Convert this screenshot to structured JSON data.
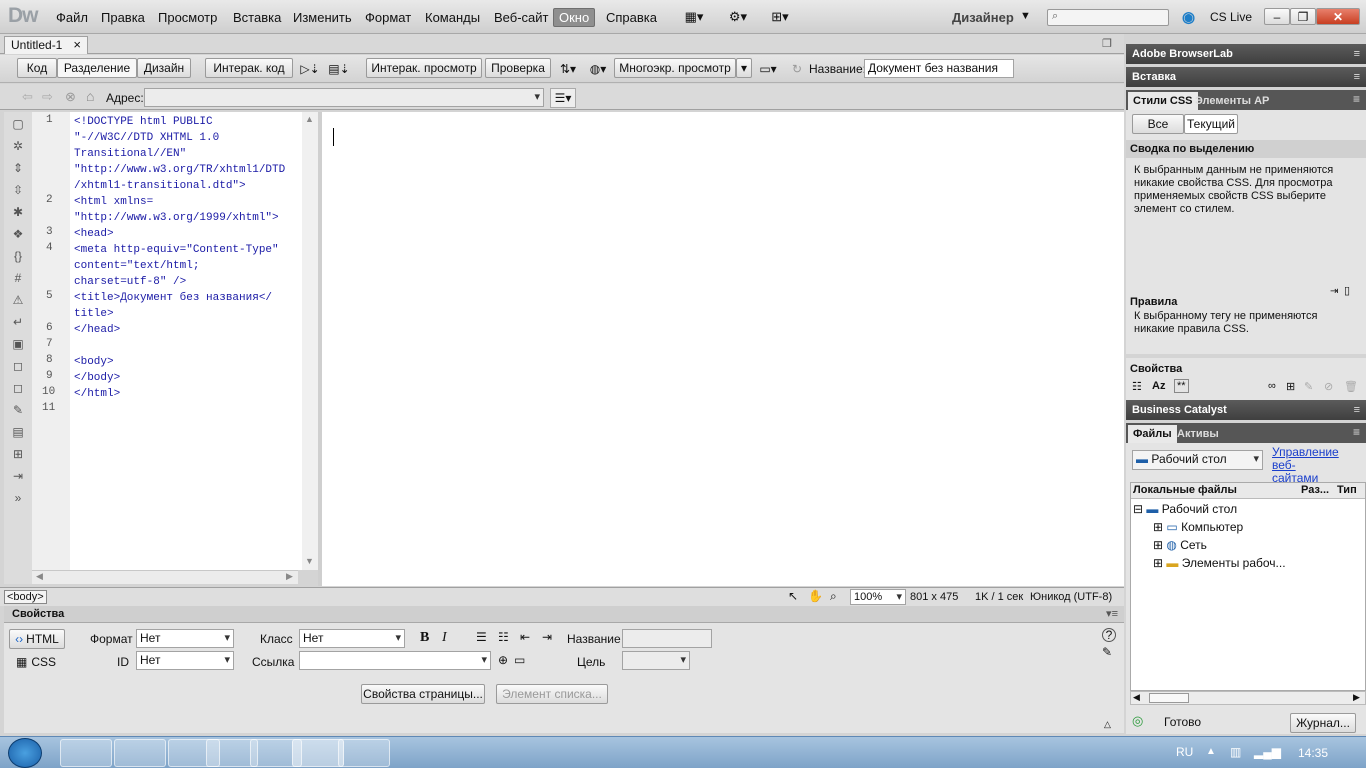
{
  "app": {
    "logo": "Dw",
    "workspace": "Дизайнер",
    "cslive": "CS Live"
  },
  "menu": [
    "Файл",
    "Правка",
    "Просмотр",
    "Вставка",
    "Изменить",
    "Формат",
    "Команды",
    "Веб-сайт",
    "Окно",
    "Справка"
  ],
  "doc_tab": {
    "title": "Untitled-1",
    "close": "×"
  },
  "toolbar": {
    "code": "Код",
    "split": "Разделение",
    "design": "Дизайн",
    "live_code": "Интерак. код",
    "live_view": "Интерак. просмотр",
    "check": "Проверка",
    "multiscreen": "Многоэкр. просмотр",
    "title_label": "Название:",
    "title_value": "Документ без названия"
  },
  "address": {
    "label": "Адрес:",
    "value": ""
  },
  "code": {
    "line_numbers": [
      "1",
      "2",
      "3",
      "4",
      "5",
      "6",
      "7",
      "8",
      "9",
      "10",
      "11"
    ],
    "text": "<!DOCTYPE html PUBLIC\n\"-//W3C//DTD XHTML 1.0\nTransitional//EN\"\n\"http://www.w3.org/TR/xhtml1/DTD\n/xhtml1-transitional.dtd\">\n<html xmlns=\n\"http://www.w3.org/1999/xhtml\">\n<head>\n<meta http-equiv=\"Content-Type\"\ncontent=\"text/html;\ncharset=utf-8\" />\n<title>Документ без названия</\ntitle>\n</head>\n\n<body>\n</body>\n</html>"
  },
  "status": {
    "tag": "<body>",
    "zoom": "100%",
    "size": "801 x 475",
    "weight": "1K / 1 сек",
    "encoding": "Юникод (UTF-8)"
  },
  "properties": {
    "title": "Свойства",
    "html_btn": "HTML",
    "css_btn": "CSS",
    "format_label": "Формат",
    "format_value": "Нет",
    "class_label": "Класс",
    "class_value": "Нет",
    "id_label": "ID",
    "id_value": "Нет",
    "link_label": "Ссылка",
    "link_value": "",
    "name_label": "Название",
    "target_label": "Цель",
    "page_props": "Свойства страницы...",
    "list_item": "Элемент списка...",
    "bold": "B",
    "italic": "I"
  },
  "panels": {
    "browserlab": "Adobe BrowserLab",
    "insert": "Вставка",
    "css_tab": "Стили CSS",
    "ap_tab": "Элементы AP",
    "all_btn": "Все",
    "current_btn": "Текущий",
    "summary_title": "Сводка по выделению",
    "summary_text": "К выбранным данным не применяются никакие свойства CSS.  Для просмотра применяемых свойств CSS выберите элемент со стилем.",
    "rules_title": "Правила",
    "rules_text": "К выбранному тегу не применяются никакие правила CSS.",
    "props_title": "Свойства",
    "bc": "Business Catalyst",
    "files_tab": "Файлы",
    "assets_tab": "Активы",
    "site_select": "Рабочий стол",
    "manage_sites": "Управление веб-сайтами",
    "col_local": "Локальные файлы",
    "col_size": "Раз...",
    "col_type": "Тип",
    "tree": [
      "Рабочий стол",
      "Компьютер",
      "Сеть",
      "Элементы рабоч..."
    ],
    "ready": "Готово",
    "log": "Журнал..."
  },
  "taskbar": {
    "lang": "RU",
    "time": "14:35"
  },
  "colors": {
    "accent_blue": "#1a1aa6",
    "panel_dark": "#4a4a4a",
    "taskbar": "#8fb0d3"
  }
}
